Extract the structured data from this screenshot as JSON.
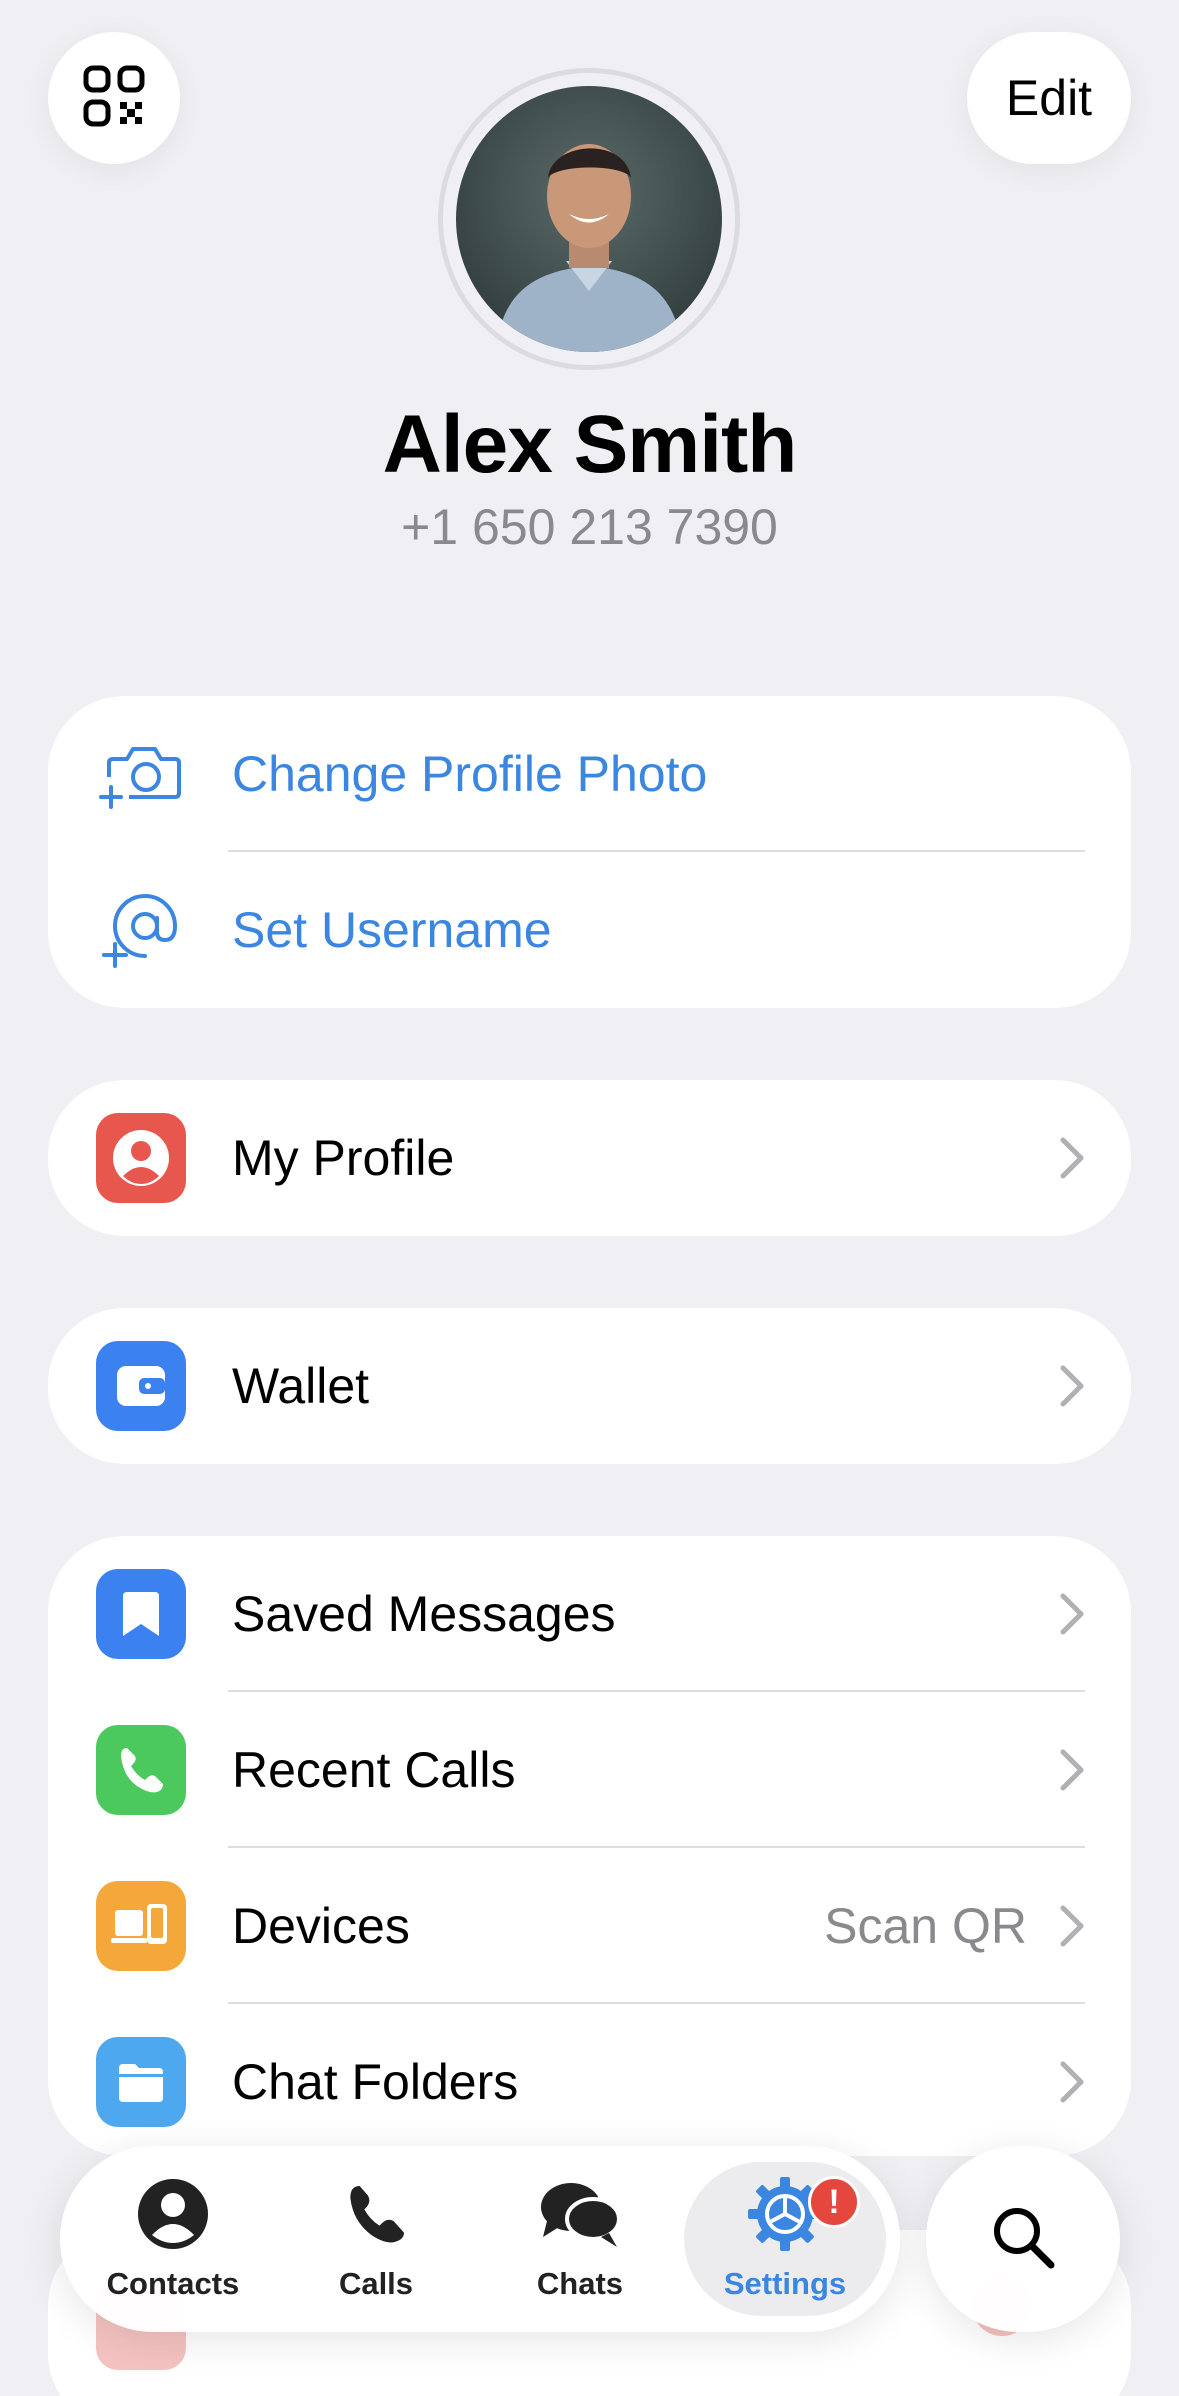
{
  "header": {
    "edit_label": "Edit",
    "qr_icon": "qr-code-icon"
  },
  "profile": {
    "name": "Alex Smith",
    "phone": "+1 650 213 7390"
  },
  "account_actions": [
    {
      "label": "Change Profile Photo",
      "icon": "camera-add-icon"
    },
    {
      "label": "Set Username",
      "icon": "at-sign-add-icon"
    }
  ],
  "my_profile": {
    "label": "My Profile",
    "icon": "person-icon",
    "color": "#e8574d"
  },
  "wallet": {
    "label": "Wallet",
    "icon": "wallet-icon",
    "color": "#3b82f0"
  },
  "menu": [
    {
      "label": "Saved Messages",
      "icon": "bookmark-icon",
      "color": "#3b82f0",
      "value": ""
    },
    {
      "label": "Recent Calls",
      "icon": "phone-icon",
      "color": "#4cc95c",
      "value": ""
    },
    {
      "label": "Devices",
      "icon": "devices-icon",
      "color": "#f4a83a",
      "value": "Scan QR"
    },
    {
      "label": "Chat Folders",
      "icon": "folder-icon",
      "color": "#4ea8f0",
      "value": ""
    }
  ],
  "tabs": [
    {
      "label": "Contacts",
      "icon": "person-circle-icon",
      "active": false
    },
    {
      "label": "Calls",
      "icon": "phone-icon",
      "active": false
    },
    {
      "label": "Chats",
      "icon": "chat-bubbles-icon",
      "active": false
    },
    {
      "label": "Settings",
      "icon": "gear-icon",
      "active": true
    }
  ],
  "settings_badge": "!",
  "colors": {
    "accent": "#3a86e0",
    "background": "#efeff4",
    "badge": "#e5473f"
  }
}
